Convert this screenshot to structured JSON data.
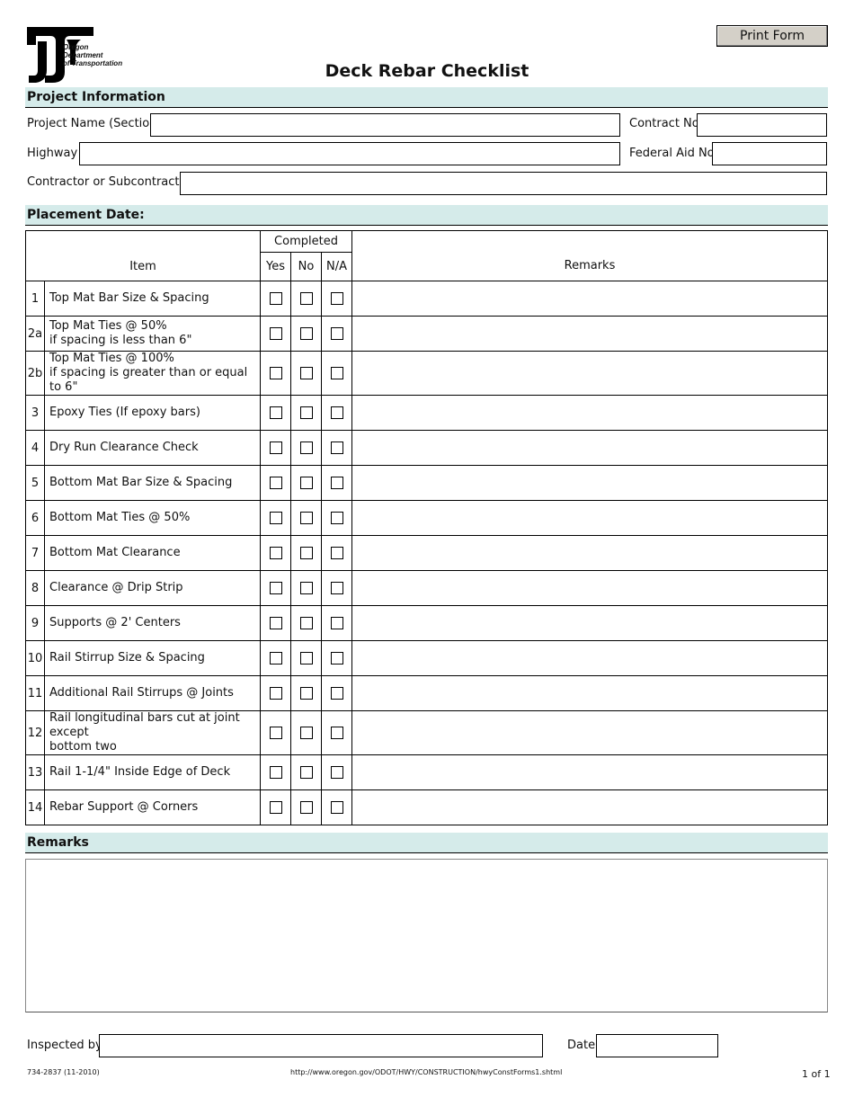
{
  "header": {
    "logo_lines": [
      "Oregon",
      "Department",
      "of Transportation"
    ],
    "print_button": "Print Form",
    "title": "Deck Rebar Checklist"
  },
  "project_info": {
    "heading": "Project Information",
    "project_name_label": "Project Name (Section)",
    "project_name_value": "",
    "contract_no_label": "Contract No.",
    "contract_no_value": "",
    "highway_label": "Highway",
    "highway_value": "",
    "federal_aid_label": "Federal Aid No.",
    "federal_aid_value": "",
    "contractor_label": "Contractor or Subcontractor",
    "contractor_value": ""
  },
  "placement": {
    "heading": "Placement Date:"
  },
  "checklist": {
    "headers": {
      "item": "Item",
      "completed": "Completed",
      "yes": "Yes",
      "no": "No",
      "na": "N/A",
      "remarks": "Remarks"
    },
    "rows": [
      {
        "num": "1",
        "line1": "Top Mat Bar Size & Spacing",
        "line2": ""
      },
      {
        "num": "2a",
        "line1": "Top Mat Ties @ 50%",
        "line2": "if spacing is less than 6\""
      },
      {
        "num": "2b",
        "line1": "Top Mat Ties @ 100%",
        "line2": "if spacing is greater than or equal  to 6\""
      },
      {
        "num": "3",
        "line1": "Epoxy Ties (If epoxy bars)",
        "line2": ""
      },
      {
        "num": "4",
        "line1": "Dry Run Clearance Check",
        "line2": ""
      },
      {
        "num": "5",
        "line1": "Bottom Mat Bar Size & Spacing",
        "line2": ""
      },
      {
        "num": "6",
        "line1": "Bottom Mat Ties @ 50%",
        "line2": ""
      },
      {
        "num": "7",
        "line1": "Bottom Mat Clearance",
        "line2": ""
      },
      {
        "num": "8",
        "line1": "Clearance @ Drip Strip",
        "line2": ""
      },
      {
        "num": "9",
        "line1": "Supports @ 2' Centers",
        "line2": ""
      },
      {
        "num": "10",
        "line1": "Rail Stirrup Size & Spacing",
        "line2": ""
      },
      {
        "num": "11",
        "line1": "Additional Rail Stirrups @ Joints",
        "line2": ""
      },
      {
        "num": "12",
        "line1": "Rail longitudinal bars cut at joint except",
        "line2": "bottom two"
      },
      {
        "num": "13",
        "line1": "Rail 1-1/4\" Inside Edge of Deck",
        "line2": ""
      },
      {
        "num": "14",
        "line1": "Rebar Support @ Corners",
        "line2": ""
      }
    ]
  },
  "remarks": {
    "heading": "Remarks",
    "value": ""
  },
  "signoff": {
    "inspected_by_label": "Inspected by",
    "inspected_by_value": "",
    "date_label": "Date",
    "date_value": ""
  },
  "footer": {
    "form_number": "734-2837 (11-2010)",
    "url": "http://www.oregon.gov/ODOT/HWY/CONSTRUCTION/hwyConstForms1.shtml",
    "page": "1 of 1"
  },
  "colors": {
    "section_bar": "#d5ebea",
    "button_face": "#d4d0c8"
  }
}
